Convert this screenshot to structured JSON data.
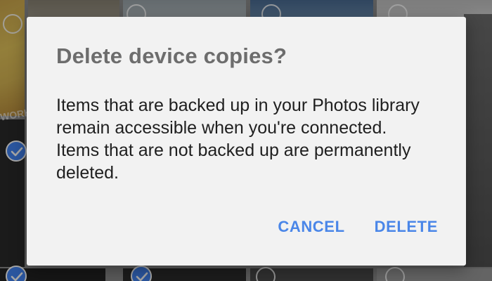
{
  "dialog": {
    "title": "Delete device copies?",
    "message": "Items that are backed up in your Photos library remain accessible when you're connected. Items that are not backed up are permanently deleted.",
    "cancel_label": "CANCEL",
    "delete_label": "DELETE"
  },
  "background": {
    "photo_text": "WORK"
  },
  "colors": {
    "accent": "#4a86e8",
    "dialog_bg": "#f2f2f2",
    "title_text": "#6d6d6d",
    "body_text": "#1f1f1f",
    "selected_badge": "#4285f4"
  },
  "icons": {
    "selection_check": "check-icon",
    "selection_empty": "selection-circle-icon"
  }
}
